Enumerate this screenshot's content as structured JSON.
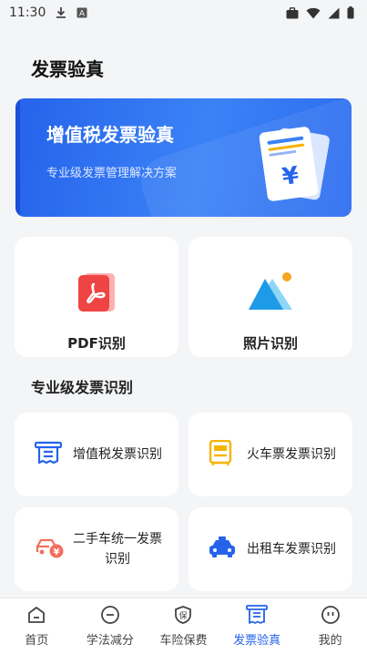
{
  "status_bar": {
    "time": "11:30",
    "icons": [
      "download-icon",
      "font-a-icon",
      "briefcase-icon",
      "wifi-icon",
      "signal-icon",
      "battery-icon"
    ]
  },
  "page": {
    "title": "发票验真"
  },
  "banner": {
    "title": "增值税发票验真",
    "subtitle": "专业级发票管理解决方案",
    "colors": {
      "start": "#2563eb",
      "end": "#3b82f6"
    }
  },
  "big_cards": [
    {
      "label": "PDF识别",
      "icon": "pdf-icon"
    },
    {
      "label": "照片识别",
      "icon": "photo-mountain-icon"
    }
  ],
  "section": {
    "title": "专业级发票识别"
  },
  "small_cards": [
    {
      "label": "增值税发票识别",
      "icon": "vat-invoice-icon"
    },
    {
      "label": "火车票发票识别",
      "icon": "train-icon"
    },
    {
      "label": "二手车统一发票识别",
      "icon": "used-car-icon"
    },
    {
      "label": "出租车发票识别",
      "icon": "taxi-icon"
    }
  ],
  "bottom_nav": [
    {
      "label": "首页",
      "icon": "home-icon"
    },
    {
      "label": "学法减分",
      "icon": "minus-circle-icon"
    },
    {
      "label": "车险保费",
      "icon": "shield-icon"
    },
    {
      "label": "发票验真",
      "icon": "invoice-icon",
      "active": true
    },
    {
      "label": "我的",
      "icon": "profile-icon"
    }
  ],
  "colors": {
    "accent": "#2563eb",
    "pdf": "#ef4444",
    "train": "#f5b400",
    "car": "#f36d5b"
  }
}
